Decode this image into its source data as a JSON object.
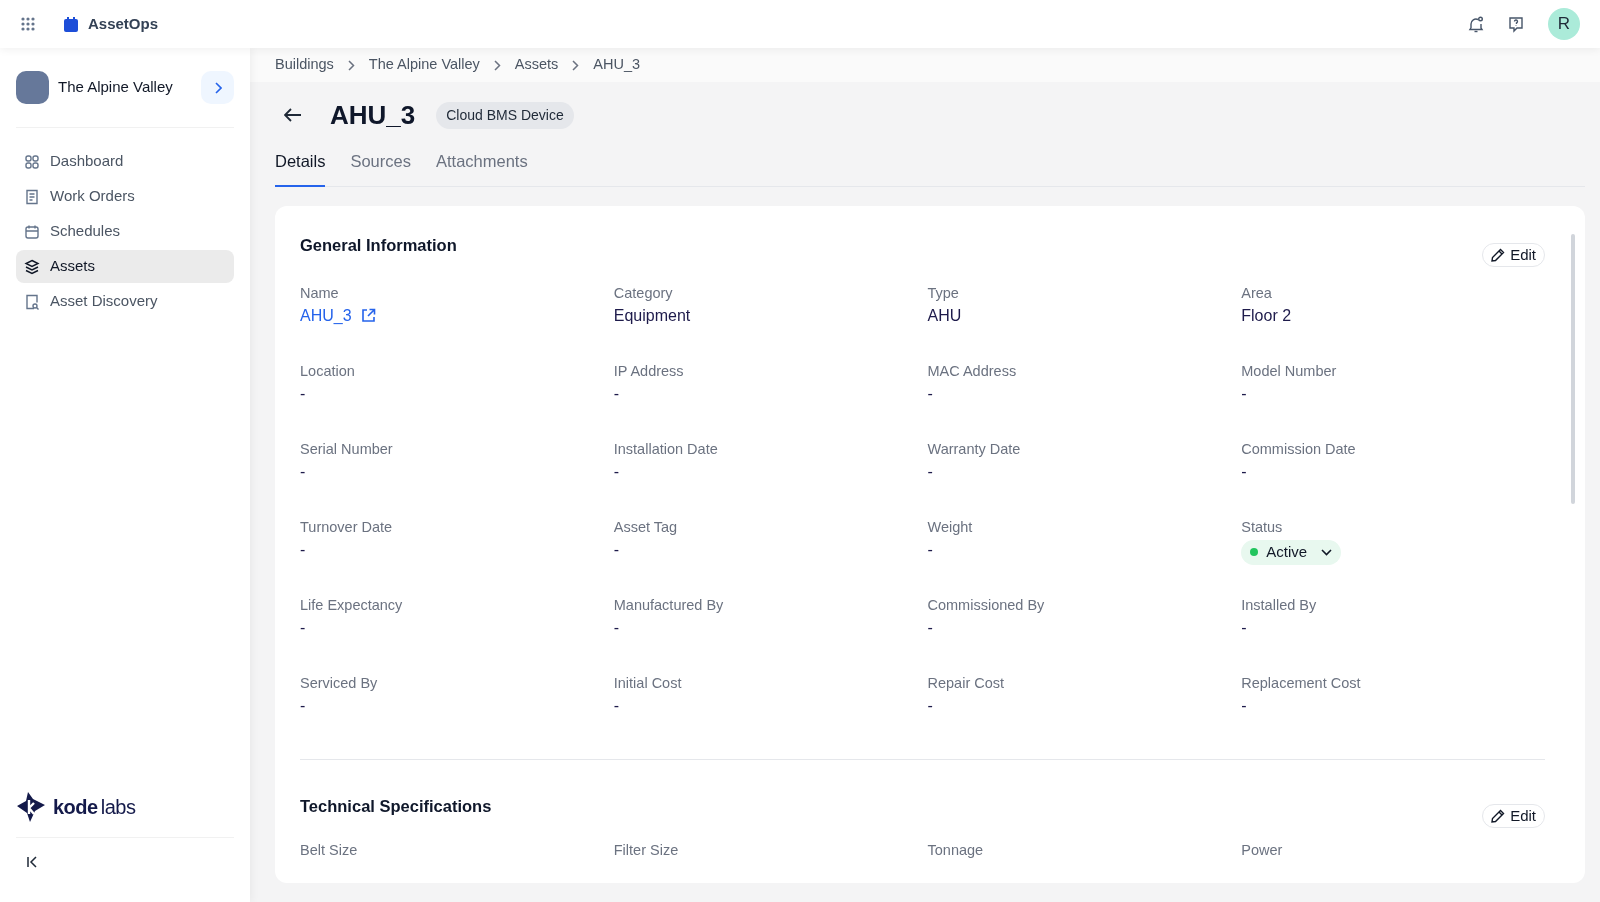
{
  "app": {
    "name": "AssetOps"
  },
  "user": {
    "initial": "R"
  },
  "sidebar": {
    "building": "The Alpine Valley",
    "items": [
      {
        "label": "Dashboard",
        "selected": false
      },
      {
        "label": "Work Orders",
        "selected": false
      },
      {
        "label": "Schedules",
        "selected": false
      },
      {
        "label": "Assets",
        "selected": true
      },
      {
        "label": "Asset Discovery",
        "selected": false
      }
    ],
    "logo": {
      "bold": "kode",
      "light": "labs"
    }
  },
  "breadcrumbs": [
    "Buildings",
    "The Alpine Valley",
    "Assets",
    "AHU_3"
  ],
  "header": {
    "title": "AHU_3",
    "badge": "Cloud BMS Device"
  },
  "tabs": [
    {
      "label": "Details",
      "selected": true
    },
    {
      "label": "Sources",
      "selected": false
    },
    {
      "label": "Attachments",
      "selected": false
    }
  ],
  "sections": [
    {
      "title": "General Information",
      "edit": "Edit",
      "fields": [
        {
          "label": "Name",
          "value": "AHU_3",
          "kind": "link"
        },
        {
          "label": "Category",
          "value": "Equipment",
          "kind": "text"
        },
        {
          "label": "Type",
          "value": "AHU",
          "kind": "text"
        },
        {
          "label": "Area",
          "value": "Floor 2",
          "kind": "text"
        },
        {
          "label": "Location",
          "value": "-",
          "kind": "text"
        },
        {
          "label": "IP Address",
          "value": "-",
          "kind": "text"
        },
        {
          "label": "MAC Address",
          "value": "-",
          "kind": "text"
        },
        {
          "label": "Model Number",
          "value": "-",
          "kind": "text"
        },
        {
          "label": "Serial Number",
          "value": "-",
          "kind": "text"
        },
        {
          "label": "Installation Date",
          "value": "-",
          "kind": "text"
        },
        {
          "label": "Warranty Date",
          "value": "-",
          "kind": "text"
        },
        {
          "label": "Commission Date",
          "value": "-",
          "kind": "text"
        },
        {
          "label": "Turnover Date",
          "value": "-",
          "kind": "text"
        },
        {
          "label": "Asset Tag",
          "value": "-",
          "kind": "text"
        },
        {
          "label": "Weight",
          "value": "-",
          "kind": "text"
        },
        {
          "label": "Status",
          "value": "Active",
          "kind": "status",
          "color": "#22c55e"
        },
        {
          "label": "Life Expectancy",
          "value": "-",
          "kind": "text"
        },
        {
          "label": "Manufactured By",
          "value": "-",
          "kind": "text"
        },
        {
          "label": "Commissioned By",
          "value": "-",
          "kind": "text"
        },
        {
          "label": "Installed By",
          "value": "-",
          "kind": "text"
        },
        {
          "label": "Serviced By",
          "value": "-",
          "kind": "text"
        },
        {
          "label": "Initial Cost",
          "value": "-",
          "kind": "text"
        },
        {
          "label": "Repair Cost",
          "value": "-",
          "kind": "text"
        },
        {
          "label": "Replacement Cost",
          "value": "-",
          "kind": "text"
        }
      ]
    },
    {
      "title": "Technical Specifications",
      "edit": "Edit",
      "fields": [
        {
          "label": "Belt Size",
          "kind": "label"
        },
        {
          "label": "Filter Size",
          "kind": "label"
        },
        {
          "label": "Tonnage",
          "kind": "label"
        },
        {
          "label": "Power",
          "kind": "label"
        }
      ]
    }
  ]
}
